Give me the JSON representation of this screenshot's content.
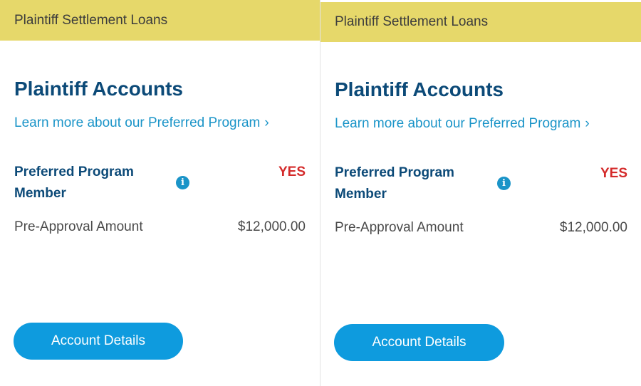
{
  "cards": [
    {
      "header": "Plaintiff Settlement Loans",
      "title": "Plaintiff Accounts",
      "link_text": "Learn more about our Preferred Program",
      "link_chevron": "›",
      "member_label": "Preferred Program Member",
      "member_value": "YES",
      "info_icon": "i",
      "pre_approval_label": "Pre-Approval Amount",
      "pre_approval_value": "$12,000.00",
      "button_label": "Account Details"
    },
    {
      "header": "Plaintiff Settlement Loans",
      "title": "Plaintiff Accounts",
      "link_text": "Learn more about our Preferred Program",
      "link_chevron": "›",
      "member_label": "Preferred Program Member",
      "member_value": "YES",
      "info_icon": "i",
      "pre_approval_label": "Pre-Approval Amount",
      "pre_approval_value": "$12,000.00",
      "button_label": "Account Details"
    }
  ],
  "colors": {
    "header_bg": "#e6d86a",
    "title": "#0c4a78",
    "link": "#1a94c8",
    "yes": "#d42a2a",
    "button": "#0e9bde"
  }
}
